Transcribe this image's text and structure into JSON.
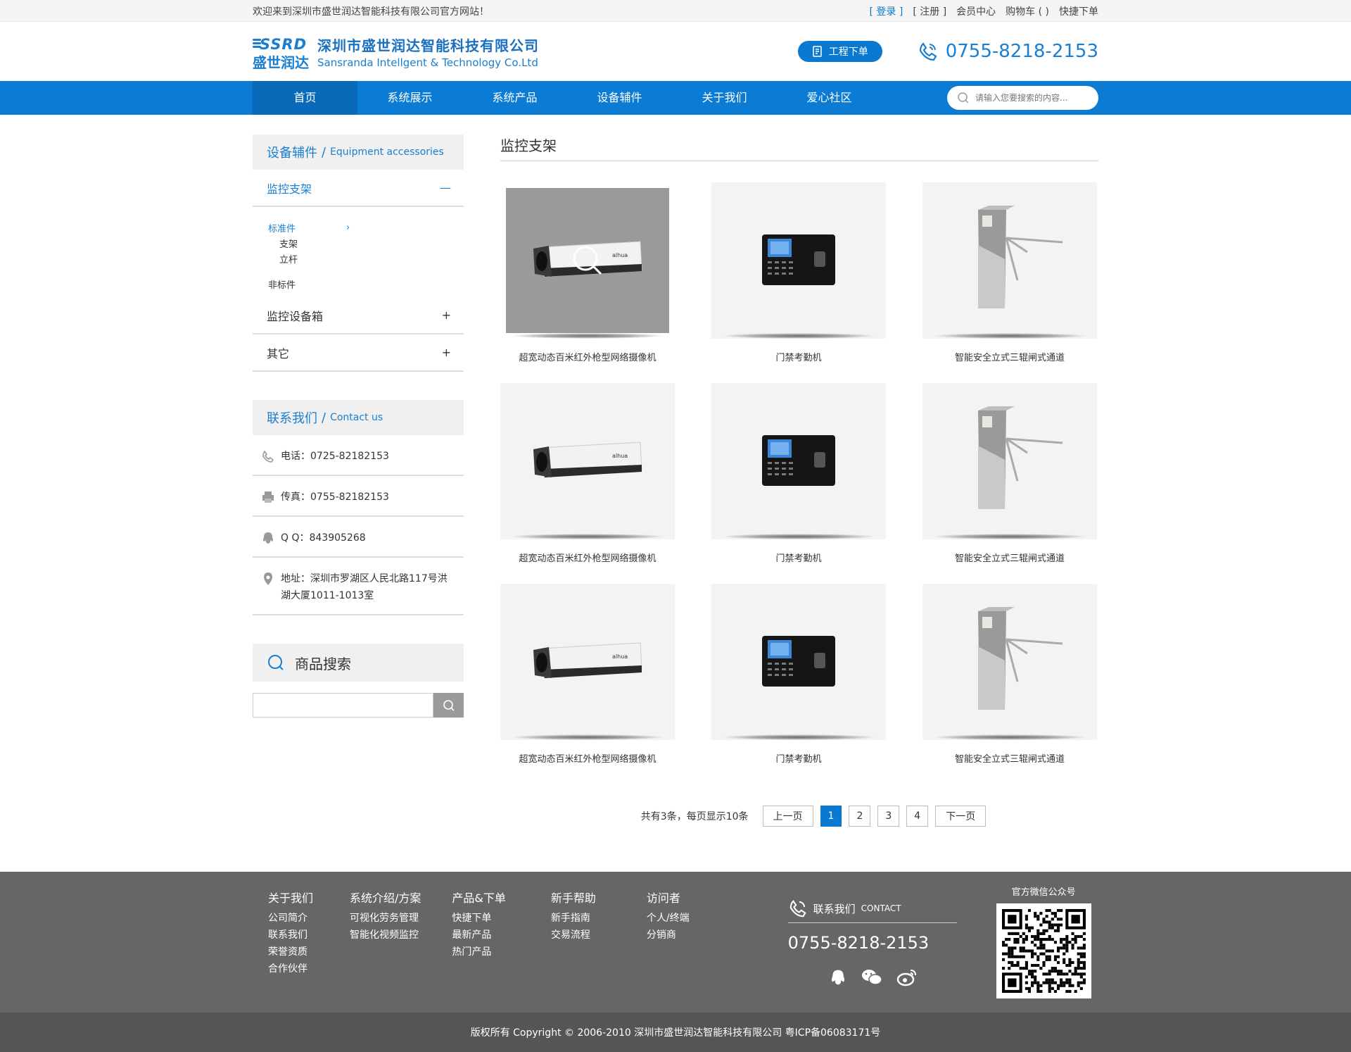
{
  "topbar": {
    "welcome": "欢迎来到深圳市盛世润达智能科技有限公司官方网站！",
    "login": "[ 登录 ]",
    "register": "[ 注册 ]",
    "member": "会员中心",
    "cart": "购物车 ( )",
    "quick_order": "快捷下单"
  },
  "header": {
    "logo_en": "SSRD",
    "logo_cn": "盛世润达",
    "company_cn": "深圳市盛世润达智能科技有限公司",
    "company_en": "Sansranda Intellgent & Technology Co.Ltd",
    "order_button": "工程下单",
    "phone": "0755-8218-2153"
  },
  "nav": {
    "items": [
      "首页",
      "系统展示",
      "系统产品",
      "设备辅件",
      "关于我们",
      "爱心社区"
    ],
    "search_placeholder": "请输入您要搜索的内容..."
  },
  "sidebar": {
    "category_title": "设备辅件",
    "category_title_en": "Equipment accessories",
    "open_category": "监控支架",
    "open_symbol": "—",
    "sub_items": {
      "standard": "标准件",
      "bracket": "支架",
      "pole": "立杆",
      "nonstandard": "非标件"
    },
    "categories": [
      {
        "label": "监控设备箱",
        "symbol": "+"
      },
      {
        "label": "其它",
        "symbol": "+"
      }
    ],
    "contact_title": "联系我们",
    "contact_title_en": "Contact us",
    "contact": {
      "tel": "电话：0725-82182153",
      "fax": "传真：0755-82182153",
      "qq": "Q Q：843905268",
      "address": "地址：深圳市罗湖区人民北路117号洪湖大厦1011-1013室"
    },
    "search_title": "商品搜索"
  },
  "content": {
    "title": "监控支架",
    "products": [
      {
        "name": "超宽动态百米红外枪型网络摄像机",
        "kind": "camera"
      },
      {
        "name": "门禁考勤机",
        "kind": "attendance"
      },
      {
        "name": "智能安全立式三辊闸式通道",
        "kind": "turnstile"
      },
      {
        "name": "超宽动态百米红外枪型网络摄像机",
        "kind": "camera"
      },
      {
        "name": "门禁考勤机",
        "kind": "attendance"
      },
      {
        "name": "智能安全立式三辊闸式通道",
        "kind": "turnstile"
      },
      {
        "name": "超宽动态百米红外枪型网络摄像机",
        "kind": "camera"
      },
      {
        "name": "门禁考勤机",
        "kind": "attendance"
      },
      {
        "name": "智能安全立式三辊闸式通道",
        "kind": "turnstile"
      }
    ],
    "camera_brand": "alhua",
    "pager": {
      "info": "共有3条，每页显示10条",
      "prev": "上一页",
      "pages": [
        "1",
        "2",
        "3",
        "4"
      ],
      "current": "1",
      "next": "下一页"
    }
  },
  "footer": {
    "columns": [
      {
        "title": "关于我们",
        "items": [
          "公司简介",
          "联系我们",
          "荣誉资质",
          "合作伙伴"
        ]
      },
      {
        "title": "系统介绍/方案",
        "items": [
          "可视化劳务管理",
          "智能化视频监控"
        ]
      },
      {
        "title": "产品&下单",
        "items": [
          "快捷下单",
          "最新产品",
          "热门产品"
        ]
      },
      {
        "title": "新手帮助",
        "items": [
          "新手指南",
          "交易流程"
        ]
      },
      {
        "title": "访问者",
        "items": [
          "个人/终端",
          "分销商"
        ]
      }
    ],
    "contact_title": "联系我们",
    "contact_title_en": "CONTACT",
    "phone": "0755-8218-2153",
    "qr_title": "官方微信公众号",
    "copyright": "版权所有  Copyright © 2006-2010  深圳市盛世润达智能科技有限公司  粤ICP备06083171号"
  },
  "colors": {
    "brand_blue": "#0b7bd3",
    "footer_gray": "#666666"
  }
}
